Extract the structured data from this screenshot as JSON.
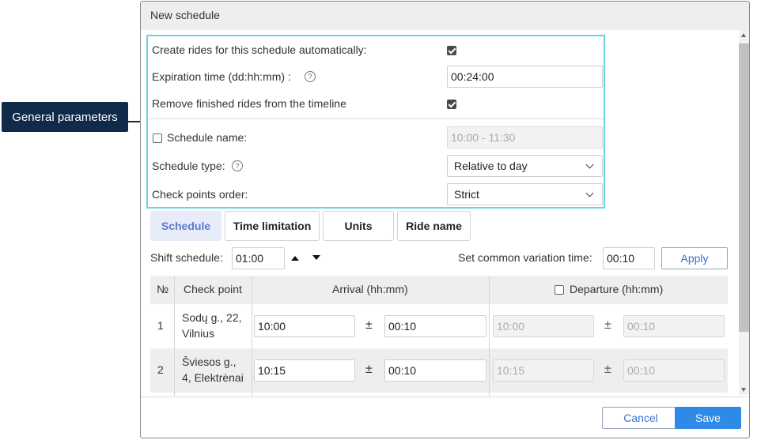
{
  "callout": {
    "label": "General parameters",
    "color": "#0f2a4a"
  },
  "dialog": {
    "title": "New schedule"
  },
  "general": {
    "auto_create_label": "Create rides for this schedule automatically:",
    "auto_create_checked": true,
    "expiration_label": "Expiration time (dd:hh:mm)  :",
    "expiration_value": "00:24:00",
    "remove_finished_label": "Remove finished rides from the timeline",
    "remove_finished_checked": true,
    "schedule_name_label": "Schedule name:",
    "schedule_name_checked": false,
    "schedule_name_value": "10:00 - 11:30",
    "schedule_type_label": "Schedule type:",
    "schedule_type_value": "Relative to day",
    "check_points_order_label": "Check points order:",
    "check_points_order_value": "Strict",
    "highlight_color": "#6ad3e3"
  },
  "tabs": [
    "Schedule",
    "Time limitation",
    "Units",
    "Ride name"
  ],
  "shift": {
    "label": "Shift schedule:",
    "value": "01:00",
    "variation_label": "Set common variation time:",
    "variation_value": "00:10",
    "apply_label": "Apply"
  },
  "table": {
    "headers": {
      "num": "№",
      "check_point": "Check point",
      "arrival": "Arrival (hh:mm)",
      "departure": "Departure (hh:mm)"
    },
    "departure_checked": false,
    "pm_symbol": "±",
    "rows": [
      {
        "num": "1",
        "check_point_line1": "Sodų g., 22,",
        "check_point_line2": "Vilnius",
        "arrival": "10:00",
        "arrival_var": "00:10",
        "departure": "10:00",
        "departure_var": "00:10"
      },
      {
        "num": "2",
        "check_point_line1": "Šviesos g.,",
        "check_point_line2": "4, Elektrėnai",
        "arrival": "10:15",
        "arrival_var": "00:10",
        "departure": "10:15",
        "departure_var": "00:10"
      }
    ]
  },
  "footer": {
    "cancel_label": "Cancel",
    "save_label": "Save",
    "save_color": "#2e8ae6"
  }
}
